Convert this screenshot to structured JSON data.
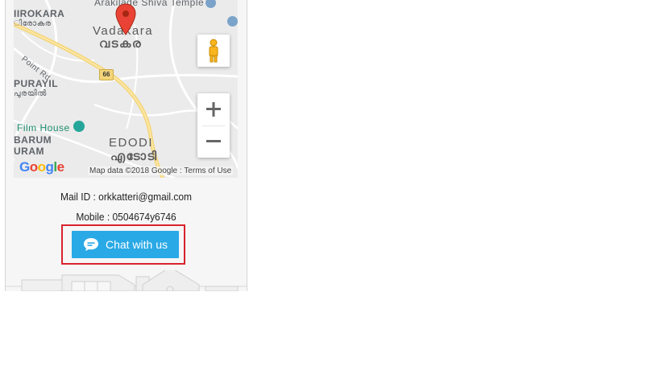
{
  "map": {
    "labels": {
      "irokara": "IIROKARA",
      "irokara_ml": "ിരോകര",
      "temple": "Arakilade Shiva Temple",
      "vadakara": "Vadakara",
      "vadakara_ml": "വടകര",
      "point_rd": "Point Rd",
      "highway": "66",
      "purayil": "PURAYIL",
      "purayil_ml": "പുരയിൽ",
      "film_house": "Film House",
      "barum": "BARUM",
      "uram": "URAM",
      "edodi": "EDODI",
      "edodi_ml": "എടോടി"
    },
    "attribution": "Map data ©2018 Google",
    "terms": "Terms of Use",
    "google_logo": "Google"
  },
  "contact": {
    "mail": "Mail ID : orkkatteri@gmail.com",
    "mobile": "Mobile : 0504674y6746"
  },
  "chat": {
    "label": "Chat with us",
    "icon": "chat-bubble-icon"
  },
  "colors": {
    "chat_button": "#29a9e6",
    "highlight": "#d9232e",
    "map_pin": "#ea4335",
    "film_house": "#26a69a"
  }
}
